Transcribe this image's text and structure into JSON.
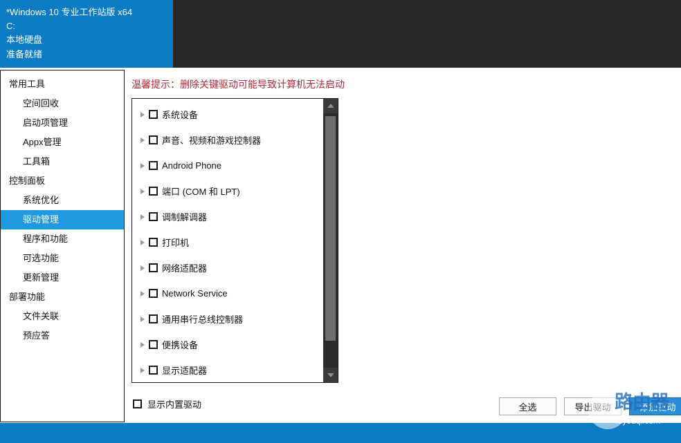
{
  "banner": {
    "lines": [
      "*Windows 10 专业工作站版 x64",
      "C:",
      "本地硬盘",
      "准备就绪"
    ]
  },
  "sidebar": {
    "groups": [
      {
        "title": "常用工具",
        "items": [
          {
            "label": "空间回收",
            "selected": false
          },
          {
            "label": "启动项管理",
            "selected": false
          },
          {
            "label": "Appx管理",
            "selected": false
          },
          {
            "label": "工具箱",
            "selected": false
          }
        ]
      },
      {
        "title": "控制面板",
        "items": [
          {
            "label": "系统优化",
            "selected": false
          },
          {
            "label": "驱动管理",
            "selected": true
          },
          {
            "label": "程序和功能",
            "selected": false
          },
          {
            "label": "可选功能",
            "selected": false
          },
          {
            "label": "更新管理",
            "selected": false
          }
        ]
      },
      {
        "title": "部署功能",
        "items": [
          {
            "label": "文件关联",
            "selected": false
          },
          {
            "label": "预应答",
            "selected": false
          }
        ]
      }
    ]
  },
  "main": {
    "warning": "温馨提示：删除关键驱动可能导致计算机无法启动",
    "tree_items": [
      {
        "label": "系统设备",
        "checked": false
      },
      {
        "label": "声音、视频和游戏控制器",
        "checked": false
      },
      {
        "label": "Android Phone",
        "checked": false
      },
      {
        "label": "端口 (COM 和 LPT)",
        "checked": false
      },
      {
        "label": "调制解调器",
        "checked": false
      },
      {
        "label": "打印机",
        "checked": false
      },
      {
        "label": "网络适配器",
        "checked": false
      },
      {
        "label": "Network Service",
        "checked": false
      },
      {
        "label": "通用串行总线控制器",
        "checked": false
      },
      {
        "label": "便携设备",
        "checked": false
      },
      {
        "label": "显示适配器",
        "checked": false
      }
    ],
    "show_builtin_label": "显示内置驱动",
    "show_builtin_checked": false,
    "buttons": [
      {
        "label": "全选",
        "primary": false
      },
      {
        "label": "导出驱动",
        "primary": false
      },
      {
        "label": "添加驱动",
        "primary": true
      }
    ]
  },
  "watermark": {
    "text": "路由器",
    "sub": "luyouqi.com"
  },
  "colors": {
    "banner_blue": "#0a7bc4",
    "banner_black": "#282828",
    "selected_blue": "#1f9ae0",
    "warning_red": "#b02a3a",
    "primary_button": "#2a8ed6"
  }
}
